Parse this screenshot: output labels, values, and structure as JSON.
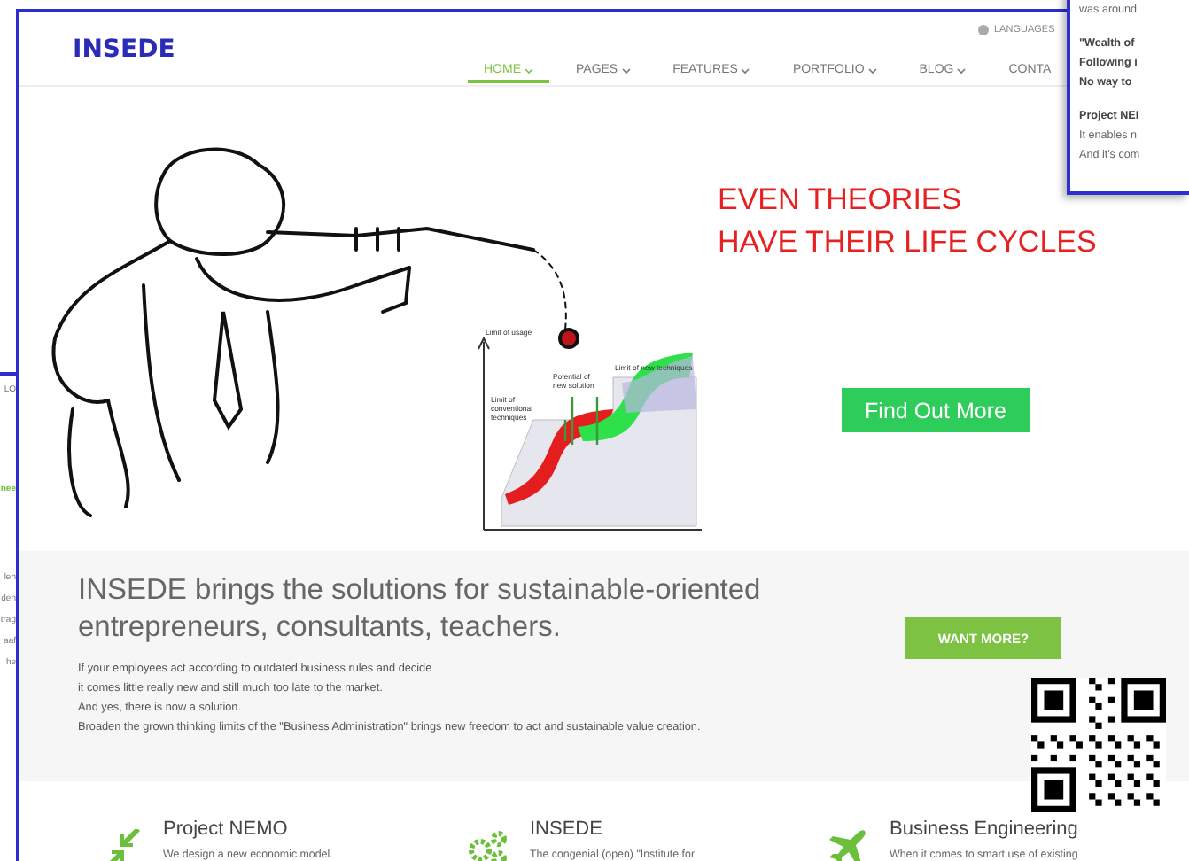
{
  "left_window": {
    "lines": [
      {
        "text": "LO",
        "kind": "plain"
      },
      {
        "text": "nee",
        "kind": "link"
      },
      {
        "text": "len",
        "kind": "plain"
      },
      {
        "text": "den",
        "kind": "plain"
      },
      {
        "text": "trag",
        "kind": "plain"
      },
      {
        "text": "aaf",
        "kind": "plain"
      },
      {
        "text": "he",
        "kind": "plain"
      }
    ]
  },
  "right_window": {
    "paragraphs": [
      {
        "lines": [
          {
            "text": "was around",
            "bold": false
          }
        ]
      },
      {
        "lines": [
          {
            "text": "\"Wealth of",
            "bold": true
          },
          {
            "text": "Following i",
            "bold": true
          },
          {
            "text": "No way to",
            "bold": true
          }
        ]
      },
      {
        "lines": [
          {
            "text": "Project NEI",
            "bold": true
          },
          {
            "text": "It enables n",
            "bold": false
          },
          {
            "text": "And it's com",
            "bold": false
          }
        ]
      }
    ]
  },
  "site": {
    "logo": "INSEDE",
    "languages": "LANGUAGES",
    "nav": [
      {
        "label": "HOME",
        "selected": true,
        "dropdown": true
      },
      {
        "label": "PAGES",
        "selected": false,
        "dropdown": true
      },
      {
        "label": "FEATURES",
        "selected": false,
        "dropdown": true
      },
      {
        "label": "PORTFOLIO",
        "selected": false,
        "dropdown": true
      },
      {
        "label": "BLOG",
        "selected": false,
        "dropdown": true
      },
      {
        "label": "CONTA",
        "selected": false,
        "dropdown": false
      }
    ]
  },
  "hero": {
    "headline": [
      "EVEN THEORIES",
      "HAVE THEIR LIFE CYCLES"
    ],
    "button": "Find Out More",
    "diagram_labels": [
      {
        "text": "Limit of usage",
        "kind": "axis"
      },
      {
        "text": "Potential of new solution",
        "kind": "potential"
      },
      {
        "text": "Limit of conventional techniques",
        "kind": "conventional"
      },
      {
        "text": "Limit of new techniques",
        "kind": "new"
      }
    ]
  },
  "intro": {
    "heading": [
      "INSEDE brings the solutions for sustainable-oriented",
      "entrepreneurs, consultants, teachers."
    ],
    "paragraph": [
      "If your employees act according to outdated business rules and decide",
      "it comes little really new and still much too late to the market.",
      "And yes, there is now a solution.",
      "Broaden the grown thinking limits of the \"Business Administration\" brings new freedom to act and sustainable value creation."
    ],
    "button": "WANT MORE?"
  },
  "features": [
    {
      "kind": "arrows",
      "title": "Project NEMO",
      "text": "We design a new economic model."
    },
    {
      "kind": "gears",
      "title": "INSEDE",
      "text": "The congenial (open) \"Institute for"
    },
    {
      "kind": "plane",
      "title": "Business Engineering",
      "text": "When it comes to smart use of existing"
    }
  ]
}
